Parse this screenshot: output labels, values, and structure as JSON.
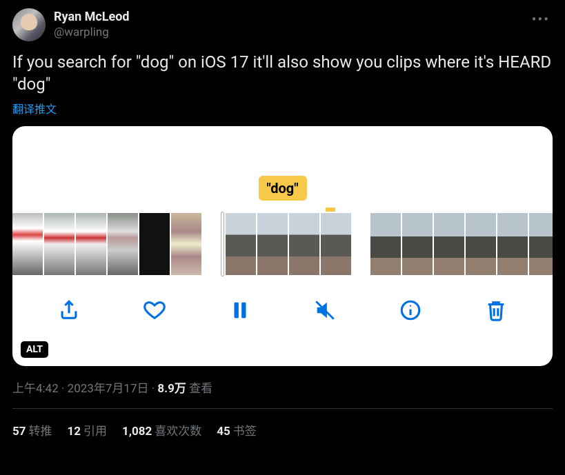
{
  "author": {
    "display_name": "Ryan McLeod",
    "handle": "@warpling"
  },
  "body": "If you search for \"dog\" on iOS 17 it'll also show you clips where it's HEARD \"dog\"",
  "translate_label": "翻译推文",
  "media": {
    "caption": "\"dog\"",
    "alt_badge": "ALT"
  },
  "meta": {
    "time": "上午4:42",
    "date": "2023年7月17日",
    "views_count": "8.9万",
    "views_label": "查看"
  },
  "stats": {
    "retweets_count": "57",
    "retweets_label": "转推",
    "quotes_count": "12",
    "quotes_label": "引用",
    "likes_count": "1,082",
    "likes_label": "喜欢次数",
    "bookmarks_count": "45",
    "bookmarks_label": "书签"
  }
}
